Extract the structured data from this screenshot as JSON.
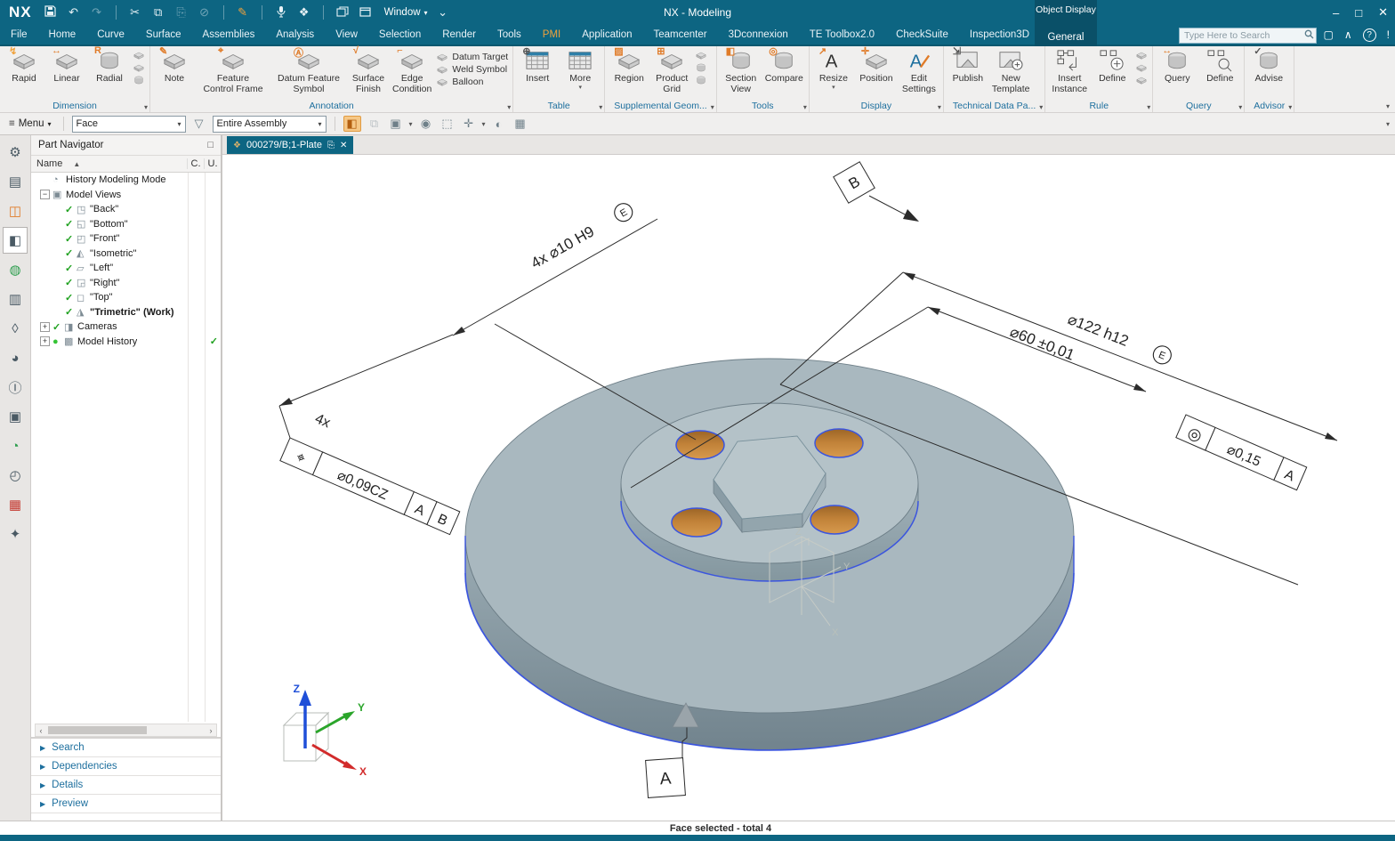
{
  "colors": {
    "titlebar_teal": "#0d6582",
    "dark_teal_block": "#0a5068",
    "active_tab_orange": "#f0a23c",
    "selection_blue": "#3b55de",
    "selected_face_orange": "#c8883c",
    "group_label_blue": "#1d6f9e"
  },
  "titlebar": {
    "app": "NX",
    "window_menu": "Window",
    "title": "NX - Modeling",
    "object_display": "Object Display",
    "general_tab": "General",
    "search_placeholder": "Type Here to Search"
  },
  "menu_tabs": [
    "File",
    "Home",
    "Curve",
    "Surface",
    "Assemblies",
    "Analysis",
    "View",
    "Selection",
    "Render",
    "Tools",
    "PMI",
    "Application",
    "Teamcenter",
    "3Dconnexion",
    "TE Toolbox2.0",
    "CheckSuite",
    "Inspection3D"
  ],
  "active_tab": "PMI",
  "ribbon": {
    "dimension": {
      "label": "Dimension",
      "rapid": "Rapid",
      "linear": "Linear",
      "radial": "Radial"
    },
    "annotation": {
      "label": "Annotation",
      "note": "Note",
      "fcf": "Feature\nControl Frame",
      "datum_feature": "Datum Feature\nSymbol",
      "surface_finish": "Surface\nFinish",
      "edge_condition": "Edge\nCondition",
      "datum_target": "Datum Target",
      "weld_symbol": "Weld Symbol",
      "balloon": "Balloon"
    },
    "table": {
      "label": "Table",
      "insert": "Insert",
      "more": "More"
    },
    "supplemental": {
      "label": "Supplemental Geom...",
      "region": "Region",
      "product_grid": "Product\nGrid"
    },
    "tools": {
      "label": "Tools",
      "section_view": "Section\nView",
      "compare": "Compare"
    },
    "display": {
      "label": "Display",
      "resize": "Resize",
      "position": "Position",
      "edit_settings": "Edit\nSettings"
    },
    "technical": {
      "label": "Technical Data Pa...",
      "publish": "Publish",
      "new_template": "New\nTemplate"
    },
    "rule": {
      "label": "Rule",
      "insert_instance": "Insert\nInstance",
      "define": "Define"
    },
    "query": {
      "label": "Query",
      "query": "Query",
      "define": "Define"
    },
    "advisor": {
      "label": "Advisor",
      "advise": "Advise"
    }
  },
  "seltoolbar": {
    "menu": "Menu",
    "selection_filter": "Face",
    "scope": "Entire Assembly"
  },
  "sidebar": {
    "glyphs": [
      "⚙",
      "▤",
      "◫",
      "◧",
      "◍",
      "▥",
      "◊",
      "◕",
      "Ⓘ",
      "▣",
      "◔",
      "◴",
      "▦",
      "✦"
    ]
  },
  "part_navigator": {
    "title": "Part Navigator",
    "col_name": "Name",
    "col_c": "C.",
    "col_u": "U.",
    "items": [
      {
        "expand": "",
        "glyph": "◔",
        "check": "",
        "label": "History Modeling Mode"
      },
      {
        "expand": "−",
        "glyph": "▣",
        "check": "",
        "label": "Model Views"
      },
      {
        "expand": "",
        "glyph": "◳",
        "check": "✓",
        "label": "\"Back\""
      },
      {
        "expand": "",
        "glyph": "◱",
        "check": "✓",
        "label": "\"Bottom\""
      },
      {
        "expand": "",
        "glyph": "◰",
        "check": "✓",
        "label": "\"Front\""
      },
      {
        "expand": "",
        "glyph": "◭",
        "check": "✓",
        "label": "\"Isometric\""
      },
      {
        "expand": "",
        "glyph": "▱",
        "check": "✓",
        "label": "\"Left\""
      },
      {
        "expand": "",
        "glyph": "◲",
        "check": "✓",
        "label": "\"Right\""
      },
      {
        "expand": "",
        "glyph": "◻",
        "check": "✓",
        "label": "\"Top\""
      },
      {
        "expand": "",
        "glyph": "◮",
        "check": "✓",
        "label": "\"Trimetric\" (Work)"
      },
      {
        "expand": "+",
        "glyph": "◨",
        "check": "✓",
        "label": "Cameras"
      },
      {
        "expand": "+",
        "glyph": "▩",
        "dot": "●",
        "check": "",
        "label": "Model History",
        "ucheck": "✓"
      }
    ],
    "sections": {
      "search": "Search",
      "dependencies": "Dependencies",
      "details": "Details",
      "preview": "Preview"
    }
  },
  "viewport": {
    "doc_tab": "000279/B;1-Plate",
    "pmi": {
      "dim_holes": "4x ⌀10 H9",
      "mod_e": "E",
      "dim_outer": "⌀122 h12",
      "dim_boss": "⌀60 ±0,01",
      "fcf_left": {
        "count": "4x",
        "symbol": "⌖",
        "tolerance": "⌀0,09CZ",
        "datum1": "A",
        "datum2": "B"
      },
      "fcf_right": {
        "symbol": "◎",
        "tolerance": "⌀0,15",
        "datum": "A"
      },
      "datum_a": "A",
      "datum_b": "B"
    },
    "triad": {
      "x": "X",
      "y": "Y",
      "z": "Z"
    },
    "csys": {
      "x": "X",
      "y": "Y",
      "z": "Z"
    }
  },
  "statusbar": {
    "message": "Face selected - total 4"
  },
  "icons": {
    "caret": "▾",
    "caret_small": "⌄",
    "hamburger": "≡",
    "sort_asc": "▲",
    "arrow_right": "▶",
    "scroll_left": "‹",
    "scroll_right": "›",
    "undo": "↶",
    "redo": "↷",
    "cut": "✂",
    "copy": "⧉",
    "paste": "⎘",
    "noselect": "⊘",
    "brush": "✎",
    "gesture": "❖",
    "minimize": "–",
    "maximize": "□",
    "close": "✕",
    "fullscreen": "▢",
    "collapse": "∧",
    "help": "?",
    "alert": "!",
    "doc_part": "❖",
    "doc_detach": "⎘",
    "snap": "◧",
    "ghost": "⧉",
    "selwin": "▣",
    "magnet": "◉",
    "addsel": "⬚",
    "cross": "✛",
    "halfsphere": "◐",
    "box": "▦",
    "funnel": "▽",
    "window_restore": "❐"
  }
}
